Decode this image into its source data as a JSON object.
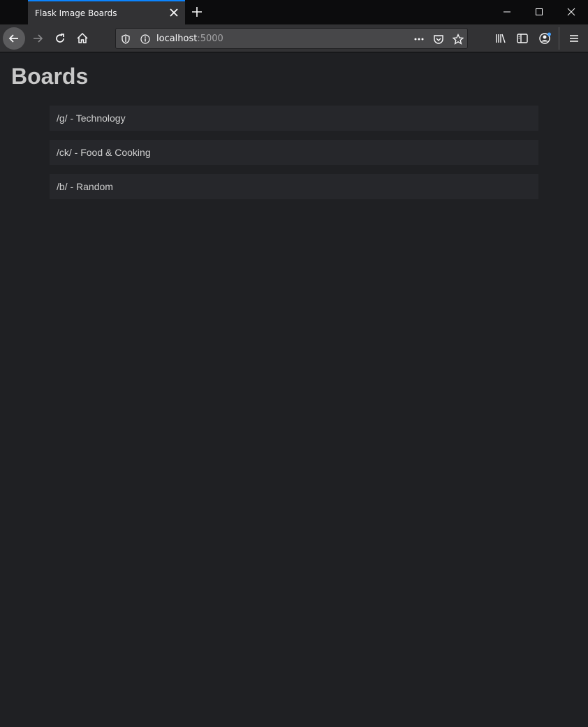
{
  "browser": {
    "tab": {
      "title": "Flask Image Boards"
    },
    "url": {
      "host": "localhost",
      "port": ":5000"
    }
  },
  "page": {
    "title": "Boards",
    "boards": [
      {
        "label": "/g/ - Technology"
      },
      {
        "label": "/ck/ - Food & Cooking"
      },
      {
        "label": "/b/ - Random"
      }
    ]
  },
  "colors": {
    "accent": "#0a84ff",
    "background": "#1f2023",
    "item_background": "#26272b"
  }
}
